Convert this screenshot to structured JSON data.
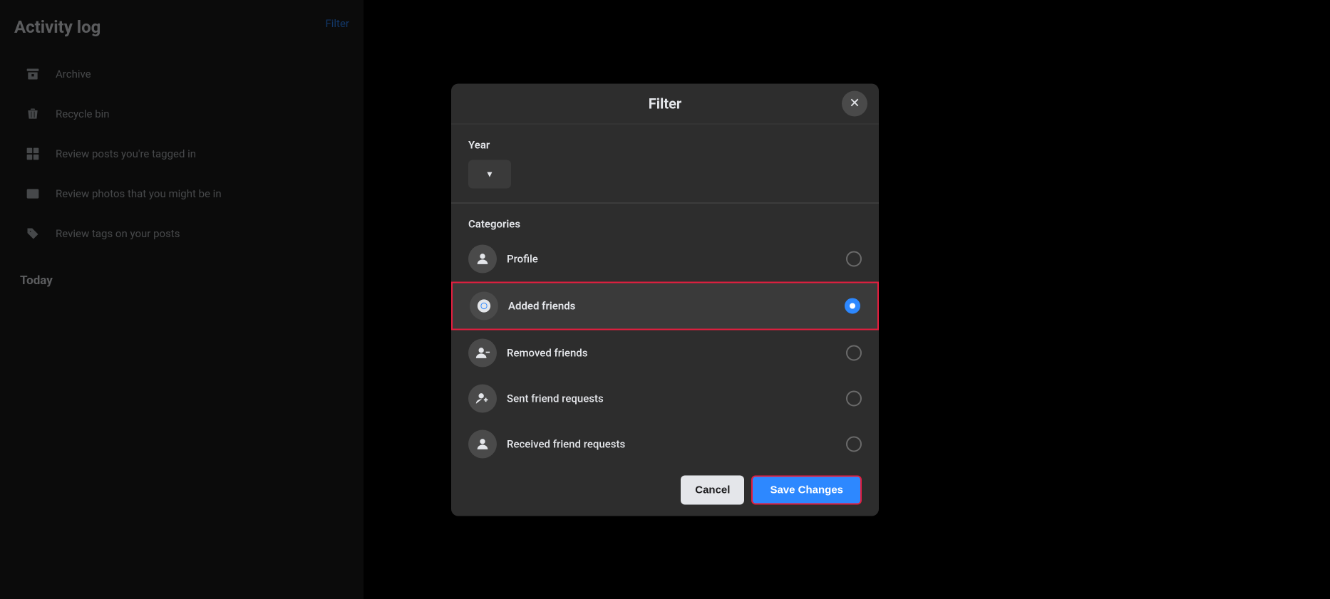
{
  "sidebar": {
    "title": "Activity log",
    "filter_link": "Filter",
    "items": [
      {
        "id": "archive",
        "label": "Archive",
        "icon": "🗃"
      },
      {
        "id": "recycle-bin",
        "label": "Recycle bin",
        "icon": "🗑"
      },
      {
        "id": "review-tagged",
        "label": "Review posts you're tagged in",
        "icon": "🖼"
      },
      {
        "id": "review-photos",
        "label": "Review photos that you might be in",
        "icon": "🖼"
      },
      {
        "id": "review-tags",
        "label": "Review tags on your posts",
        "icon": "🏷"
      }
    ],
    "section_today": "Today"
  },
  "modal": {
    "title": "Filter",
    "close_label": "✕",
    "year_section": "Year",
    "year_dropdown_icon": "▼",
    "categories_section": "Categories",
    "categories": [
      {
        "id": "profile",
        "label": "Profile",
        "icon": "person",
        "selected": false
      },
      {
        "id": "added-friends",
        "label": "Added friends",
        "icon": "facebook",
        "selected": true
      },
      {
        "id": "removed-friends",
        "label": "Removed friends",
        "icon": "person",
        "selected": false
      },
      {
        "id": "sent-requests",
        "label": "Sent friend requests",
        "icon": "person-plus",
        "selected": false
      },
      {
        "id": "received-requests",
        "label": "Received friend requests",
        "icon": "person",
        "selected": false
      }
    ],
    "cancel_label": "Cancel",
    "save_label": "Save Changes"
  }
}
